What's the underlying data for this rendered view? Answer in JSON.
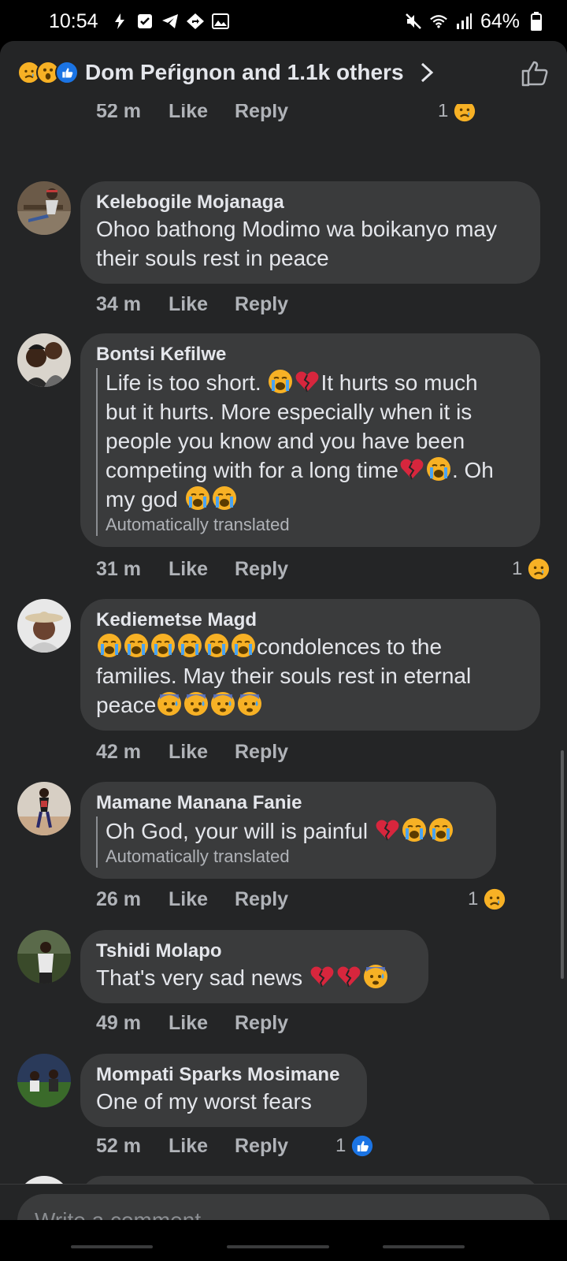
{
  "status_bar": {
    "time": "10:54",
    "battery": "64%"
  },
  "header": {
    "reaction_text": "Dom Peŕignon and 1.1k others"
  },
  "partial_top": {
    "time": "52 m",
    "like": "Like",
    "reply": "Reply",
    "count": "1"
  },
  "comments": [
    {
      "name": "Kelebogile Mojanaga",
      "lines": [
        "Ohoo bathong Modimo wa boikanyo may",
        "their souls rest in peace"
      ],
      "time": "34 m",
      "like": "Like",
      "reply": "Reply"
    },
    {
      "name": "Bontsi Kefilwe",
      "text_pre": "Life is too short.",
      "text_mid": "It hurts so much",
      "line2": "but it hurts. More especially when it is",
      "line3": "people you know and you have been",
      "line4": "competing with for a long time",
      "line4_end": ". Oh",
      "line5": "my god",
      "translated": "Automatically translated",
      "time": "31 m",
      "like": "Like",
      "reply": "Reply",
      "reaction_count": "1"
    },
    {
      "name": "Kediemetse Magd",
      "line1": "condolences to the",
      "line2": "families. May their souls rest in eternal",
      "line3": "peace",
      "time": "42 m",
      "like": "Like",
      "reply": "Reply"
    },
    {
      "name": "Mamane Manana Fanie",
      "text": "Oh God, your will is painful",
      "translated": "Automatically translated",
      "time": "26 m",
      "like": "Like",
      "reply": "Reply",
      "reaction_count": "1"
    },
    {
      "name": "Tshidi Molapo",
      "text": "That's very sad news",
      "time": "49 m",
      "like": "Like",
      "reply": "Reply"
    },
    {
      "name": "Mompati Sparks Mosimane",
      "text": "One of my worst fears",
      "time": "52 m",
      "like": "Like",
      "reply": "Reply",
      "reaction_count": "1"
    }
  ],
  "composer": {
    "placeholder": "Write a comment…"
  },
  "colors": {
    "background": "#242526",
    "bubble": "#3a3b3c",
    "text": "#e4e6eb",
    "muted": "#b0b3b8",
    "like_blue": "#1b74e4",
    "emoji_yellow": "#f7b125",
    "heart_red": "#d7263d"
  },
  "icons": [
    "sad-emoji-icon",
    "wow-emoji-icon",
    "like-reaction-icon",
    "chevron-right-icon",
    "thumbs-up-icon",
    "crying-emoji-icon",
    "broken-heart-icon",
    "anxious-emoji-icon"
  ]
}
